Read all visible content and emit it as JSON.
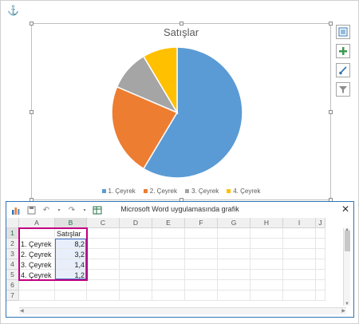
{
  "chart": {
    "title": "Satışlar",
    "legend": [
      "1. Çeyrek",
      "2. Çeyrek",
      "3. Çeyrek",
      "4. Çeyrek"
    ]
  },
  "chart_data": {
    "type": "pie",
    "title": "Satışlar",
    "categories": [
      "1. Çeyrek",
      "2. Çeyrek",
      "3. Çeyrek",
      "4. Çeyrek"
    ],
    "values": [
      8.2,
      3.2,
      1.4,
      1.2
    ],
    "colors": [
      "#5b9bd5",
      "#ed7d31",
      "#a5a5a5",
      "#ffc000"
    ],
    "legend_position": "bottom"
  },
  "side_buttons": [
    "chart-layout-icon",
    "chart-elements-icon",
    "chart-styles-icon",
    "chart-filters-icon"
  ],
  "sheet": {
    "title": "Microsoft Word uygulamasında grafik",
    "close": "✕",
    "columns": [
      "A",
      "B",
      "C",
      "D",
      "E",
      "F",
      "G",
      "H",
      "I",
      "J"
    ],
    "rows": [
      "1",
      "2",
      "3",
      "4",
      "5",
      "6",
      "7"
    ],
    "header_b1": "Satışlar",
    "row_labels": [
      "1. Çeyrek",
      "2. Çeyrek",
      "3. Çeyrek",
      "4. Çeyrek"
    ],
    "row_values": [
      "8,2",
      "3,2",
      "1,4",
      "1,2"
    ]
  }
}
